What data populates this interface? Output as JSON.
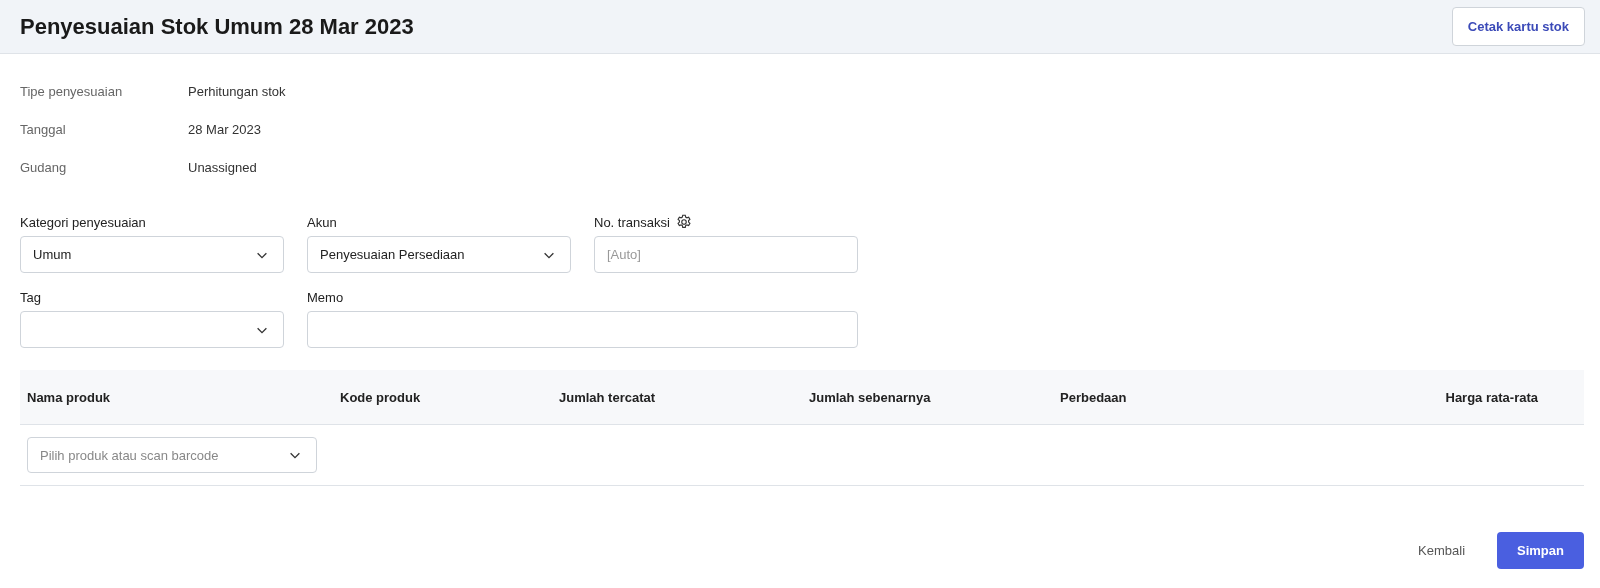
{
  "header": {
    "title": "Penyesuaian Stok Umum 28 Mar 2023",
    "print_button": "Cetak kartu stok"
  },
  "info": [
    {
      "label": "Tipe penyesuaian",
      "value": "Perhitungan stok"
    },
    {
      "label": "Tanggal",
      "value": "28 Mar 2023"
    },
    {
      "label": "Gudang",
      "value": "Unassigned"
    }
  ],
  "form_rows": [
    [
      {
        "label": "Kategori penyesuaian",
        "kind": "select",
        "value": "Umum"
      },
      {
        "label": "Akun",
        "kind": "select",
        "value": "Penyesuaian Persediaan"
      },
      {
        "label": "No. transaksi",
        "kind": "text",
        "settings": true,
        "placeholder": "[Auto]"
      }
    ],
    [
      {
        "label": "Tag",
        "kind": "select"
      },
      {
        "label": "Memo",
        "kind": "wide"
      }
    ]
  ],
  "table": {
    "columns": [
      "Nama produk",
      "Kode produk",
      "Jumlah tercatat",
      "Jumlah sebenarnya",
      "Perbedaan",
      "Harga rata-rata"
    ],
    "product_select": {
      "placeholder": "Pilih produk atau scan barcode"
    }
  },
  "footer": {
    "back": "Kembali",
    "save": "Simpan"
  }
}
